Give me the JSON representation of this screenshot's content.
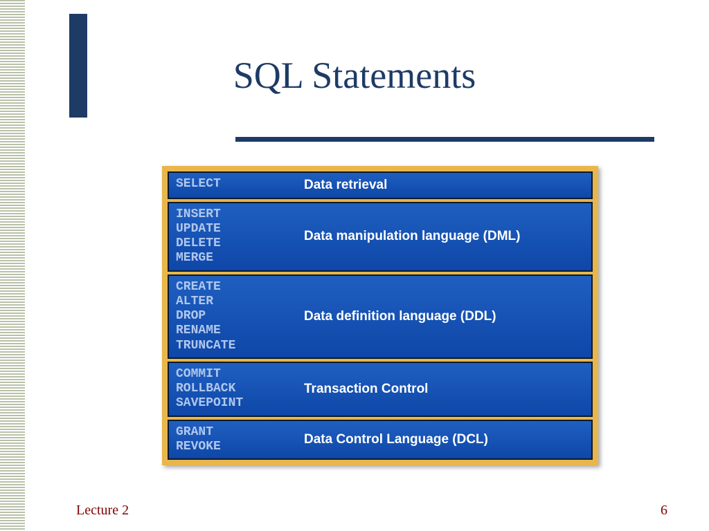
{
  "title": "SQL Statements",
  "footer": {
    "left": "Lecture 2",
    "right": "6"
  },
  "rows": [
    {
      "cmds": "SELECT",
      "desc": "Data retrieval"
    },
    {
      "cmds": "INSERT\nUPDATE\nDELETE\nMERGE",
      "desc": "Data manipulation language (DML)"
    },
    {
      "cmds": "CREATE\nALTER\nDROP\nRENAME\nTRUNCATE",
      "desc": "Data definition language (DDL)"
    },
    {
      "cmds": "COMMIT\nROLLBACK\nSAVEPOINT",
      "desc": "Transaction Control"
    },
    {
      "cmds": "GRANT\nREVOKE",
      "desc": "Data Control Language (DCL)"
    }
  ]
}
